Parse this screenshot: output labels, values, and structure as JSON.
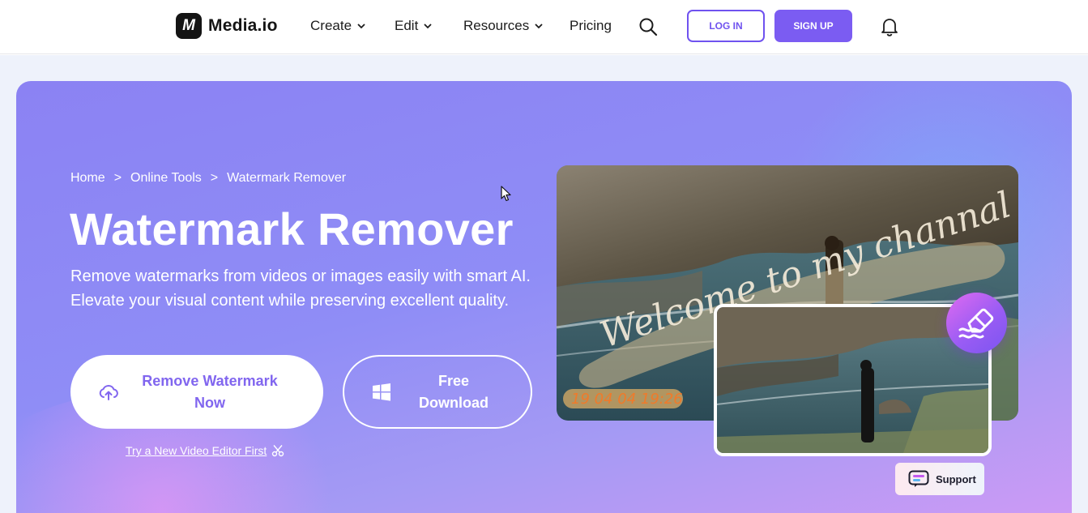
{
  "header": {
    "logo_mark": "M",
    "logo_text": "Media.io",
    "nav": [
      {
        "label": "Create",
        "has_dropdown": true
      },
      {
        "label": "Edit",
        "has_dropdown": true
      },
      {
        "label": "Resources",
        "has_dropdown": true
      },
      {
        "label": "Pricing",
        "has_dropdown": false
      }
    ],
    "login_label": "LOG IN",
    "signup_label": "SIGN UP"
  },
  "hero": {
    "breadcrumb": [
      "Home",
      "Online Tools",
      "Watermark Remover"
    ],
    "breadcrumb_separator": ">",
    "title": "Watermark Remover",
    "description": "Remove watermarks from videos or images easily with smart AI. Elevate your visual content while preserving excellent quality.",
    "remove_button_line1": "Remove Watermark",
    "remove_button_line2": "Now",
    "free_download_line1": "Free",
    "free_download_line2": "Download",
    "try_link": "Try a New Video Editor First"
  },
  "media": {
    "watermark_text": "Welcome to my channal",
    "timestamp": "19 04 04 19:26"
  },
  "support_label": "Support",
  "colors": {
    "accent": "#7b5cf2",
    "hero_start": "#8b82f3",
    "hero_end": "#d09af5",
    "button_text": "#8166ef"
  }
}
